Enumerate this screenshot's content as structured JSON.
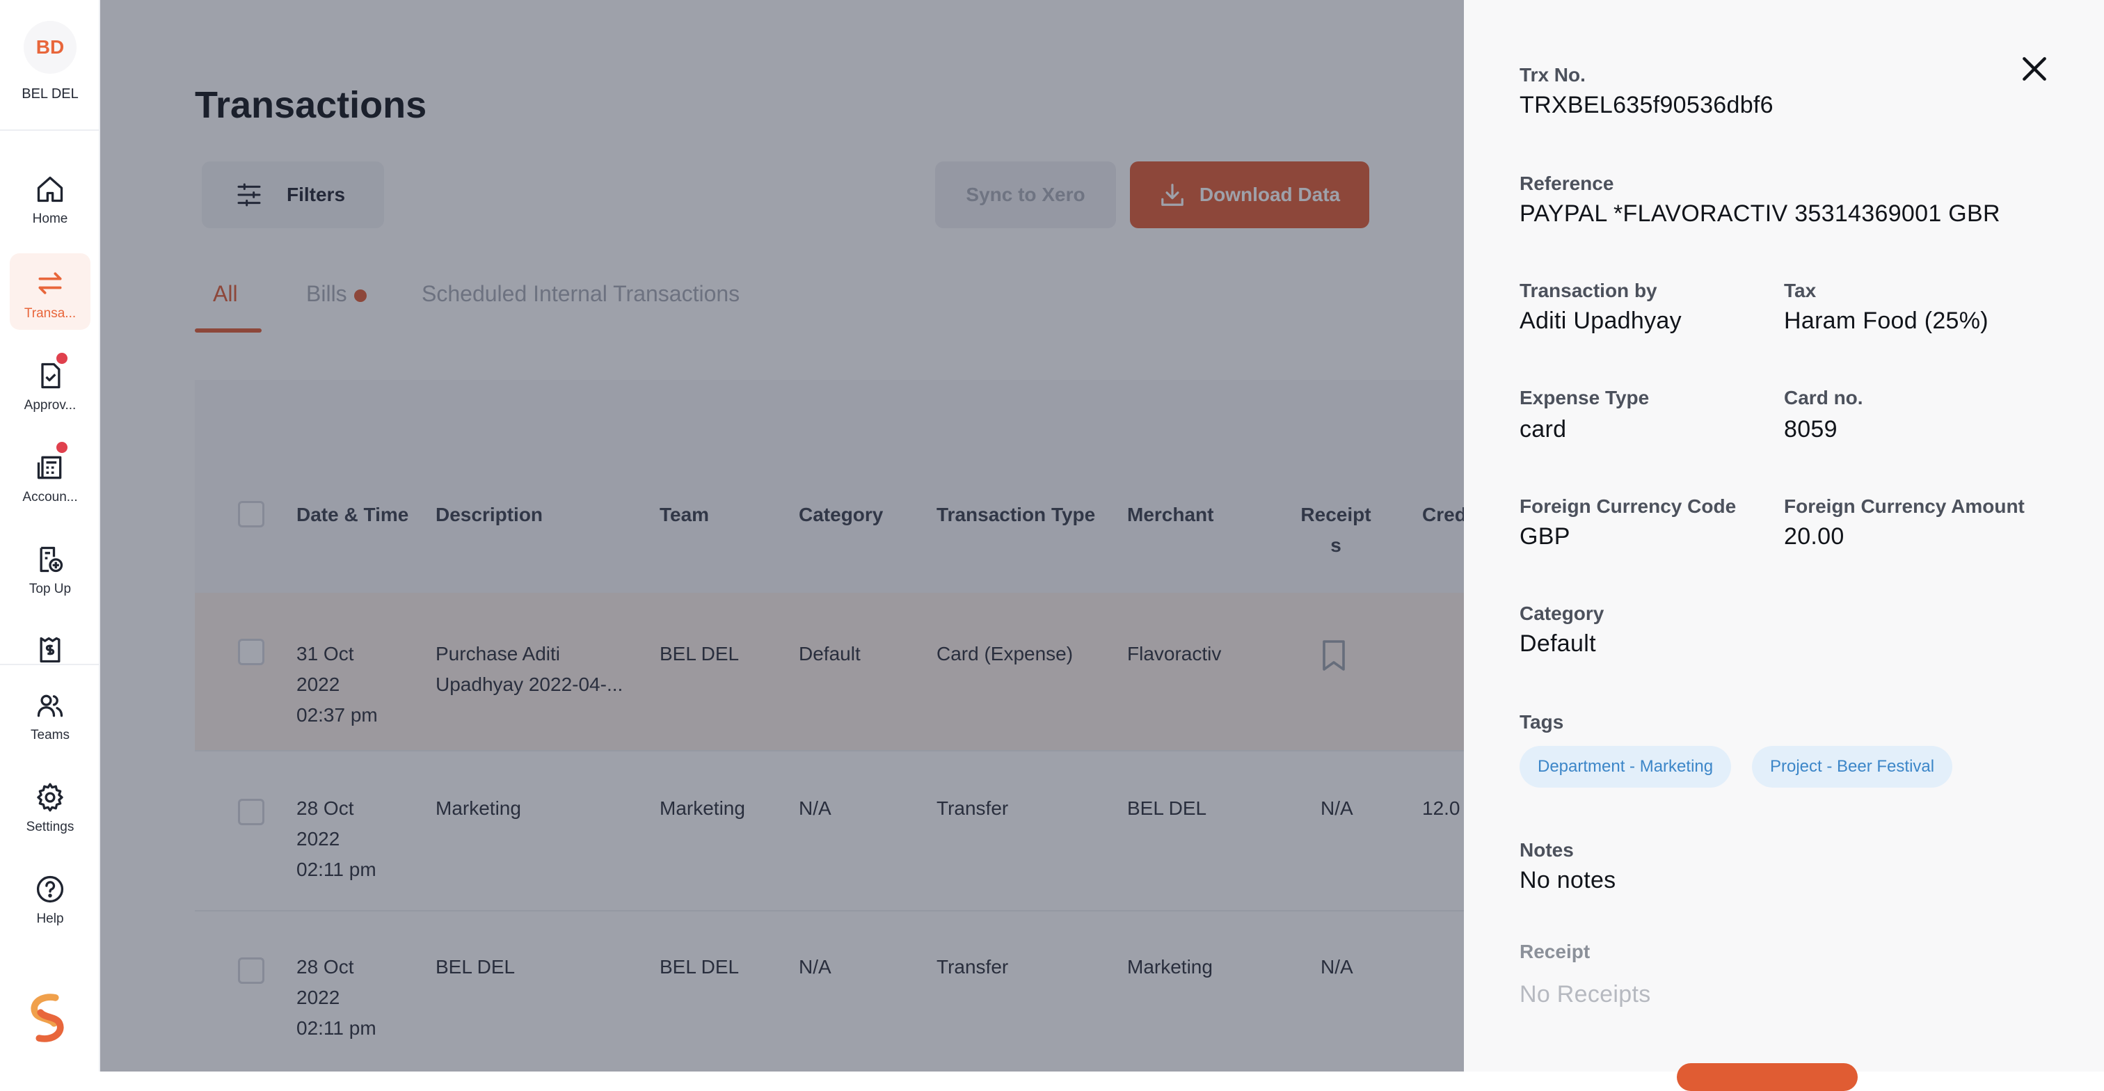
{
  "sidebar": {
    "org_initials": "BD",
    "org_name": "BEL DEL",
    "items": [
      {
        "label": "Home",
        "icon": "home-icon"
      },
      {
        "label": "Transa...",
        "icon": "transfer-arrows-icon",
        "active": true
      },
      {
        "label": "Approv...",
        "icon": "approval-document-icon",
        "badge": true
      },
      {
        "label": "Accoun...",
        "icon": "accounting-icon",
        "badge": true
      },
      {
        "label": "Top Up",
        "icon": "top-up-icon"
      },
      {
        "label": "",
        "icon": "bill-dollar-icon"
      },
      {
        "label": "Teams",
        "icon": "teams-icon"
      },
      {
        "label": "Settings",
        "icon": "gear-icon"
      },
      {
        "label": "Help",
        "icon": "help-icon"
      }
    ]
  },
  "main": {
    "title": "Transactions",
    "filters_label": "Filters",
    "sync_label": "Sync to Xero",
    "download_label": "Download Data",
    "tabs": [
      {
        "label": "All",
        "active": true
      },
      {
        "label": "Bills",
        "dot": true
      },
      {
        "label": "Scheduled Internal Transactions"
      }
    ],
    "table": {
      "headers": [
        "Date & Time",
        "Description",
        "Team",
        "Category",
        "Transaction Type",
        "Merchant",
        "Receipt",
        "s",
        "Cred"
      ],
      "rows": [
        {
          "date": "31 Oct",
          "year": "2022",
          "time": "02:37 pm",
          "description_1": "Purchase Aditi",
          "description_2": "Upadhyay 2022-04-...",
          "team": "BEL DEL",
          "category": "Default",
          "type": "Card (Expense)",
          "merchant": "Flavoractiv",
          "receipts": "",
          "credit": ""
        },
        {
          "date": "28 Oct",
          "year": "2022",
          "time": "02:11 pm",
          "description_1": "Marketing",
          "description_2": "",
          "team": "Marketing",
          "category": "N/A",
          "type": "Transfer",
          "merchant": "BEL DEL",
          "receipts": "N/A",
          "credit": "12.0"
        },
        {
          "date": "28 Oct",
          "year": "2022",
          "time": "02:11 pm",
          "description_1": "BEL DEL",
          "description_2": "",
          "team": "BEL DEL",
          "category": "N/A",
          "type": "Transfer",
          "merchant": "Marketing",
          "receipts": "N/A",
          "credit": ""
        }
      ]
    }
  },
  "drawer": {
    "trx_no_label": "Trx No.",
    "trx_no": "TRXBEL635f90536dbf6",
    "reference_label": "Reference",
    "reference": "PAYPAL *FLAVORACTIV 35314369001 GBR",
    "transaction_by_label": "Transaction by",
    "transaction_by": "Aditi Upadhyay",
    "tax_label": "Tax",
    "tax": "Haram Food (25%)",
    "expense_type_label": "Expense Type",
    "expense_type": "card",
    "card_no_label": "Card no.",
    "card_no": "8059",
    "fcc_label": "Foreign Currency Code",
    "fcc": "GBP",
    "fca_label": "Foreign Currency Amount",
    "fca": "20.00",
    "category_label": "Category",
    "category": "Default",
    "tags_label": "Tags",
    "tags": [
      "Department - Marketing",
      "Project - Beer Festival"
    ],
    "notes_label": "Notes",
    "notes": "No notes",
    "receipt_label": "Receipt",
    "receipt": "No Receipts"
  },
  "colors": {
    "accent": "#e05c33",
    "badge_red": "#e0404d",
    "tag_bg": "#e3effa",
    "tag_text": "#3c86c8"
  }
}
